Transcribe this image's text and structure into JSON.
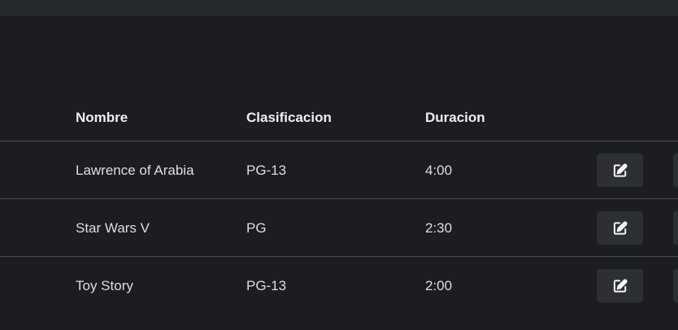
{
  "table": {
    "headers": {
      "nombre": "Nombre",
      "clasificacion": "Clasificacion",
      "duracion": "Duracion"
    },
    "rows": [
      {
        "nombre": "Lawrence of Arabia",
        "clasificacion": "PG-13",
        "duracion": "4:00"
      },
      {
        "nombre": "Star Wars V",
        "clasificacion": "PG",
        "duracion": "2:30"
      },
      {
        "nombre": "Toy Story",
        "clasificacion": "PG-13",
        "duracion": "2:00"
      }
    ],
    "row_actions": [
      "edit-icon",
      "delete-icon"
    ]
  },
  "colors": {
    "background": "#1b1d21",
    "topbar": "#25282c",
    "button": "#2c2f34",
    "divider": "#4a4d52"
  }
}
